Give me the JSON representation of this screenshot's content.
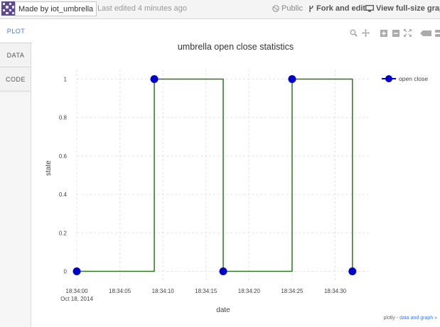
{
  "topbar": {
    "made_by": "Made by iot_umbrella",
    "last_edited": "Last edited 4 minutes ago",
    "public_label": "Public",
    "fork_label": "Fork and edit",
    "fullsize_label": "View full-size graph"
  },
  "tabs": [
    "PLOT",
    "DATA",
    "CODE"
  ],
  "modebar_icons": [
    "zoom-icon",
    "pan-icon",
    "zoom-in-icon",
    "zoom-out-icon",
    "autoscale-icon",
    "toggle-spikelines-icon",
    "hover-compare-icon"
  ],
  "chart_data": {
    "type": "line",
    "title": "umbrella open close statistics",
    "xlabel": "date",
    "ylabel": "state",
    "line_shape": "hv",
    "series": [
      {
        "name": "open close",
        "color": "#0000cc",
        "line_color": "#2a7a1c",
        "x": [
          "18:34:00",
          "18:34:09",
          "18:34:17",
          "18:34:25",
          "18:34:32"
        ],
        "y": [
          0,
          1,
          0,
          1,
          0
        ]
      }
    ],
    "x_ticks": [
      "18:34:00",
      "18:34:05",
      "18:34:10",
      "18:34:15",
      "18:34:20",
      "18:34:25",
      "18:34:30"
    ],
    "x_tick_date": "Oct 18, 2014",
    "y_ticks": [
      "0",
      "0.2",
      "0.4",
      "0.6",
      "0.8",
      "1"
    ],
    "xlim": [
      0,
      34
    ],
    "ylim": [
      -0.05,
      1.05
    ],
    "grid": true,
    "legend_position": "top-right"
  },
  "credit": {
    "prefix": "plotly - ",
    "link": "data and graph »"
  }
}
